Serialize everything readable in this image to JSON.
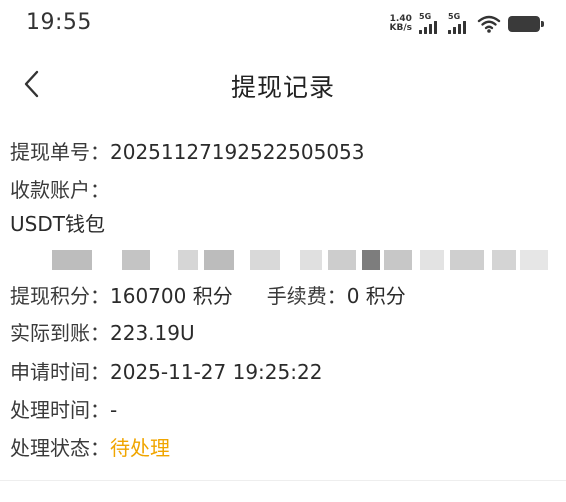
{
  "status_bar": {
    "time": "19:55",
    "net_speed_value": "1.40",
    "net_speed_unit": "KB/s",
    "sim1_label": "5G",
    "sim2_label": "5G",
    "icons": [
      "signal-icon",
      "signal-icon",
      "wifi-icon",
      "battery-icon"
    ]
  },
  "header": {
    "title": "提现记录",
    "back_icon": "chevron-left-icon"
  },
  "details": {
    "order_no_label": "提现单号：",
    "order_no_value": "20251127192522505053",
    "account_label": "收款账户：",
    "account_type": "USDT钱包",
    "points_label": "提现积分：",
    "points_value": "160700 积分",
    "fee_label": "手续费：",
    "fee_value": "0 积分",
    "actual_label": "实际到账：",
    "actual_value": "223.19U",
    "apply_time_label": "申请时间：",
    "apply_time_value": "2025-11-27 19:25:22",
    "process_time_label": "处理时间：",
    "process_time_value": "-",
    "status_label": "处理状态：",
    "status_value": "待处理",
    "status_color": "#f0a500"
  }
}
